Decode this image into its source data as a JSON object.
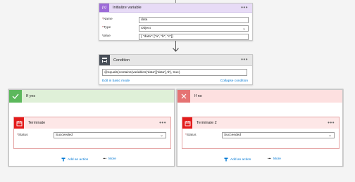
{
  "init_variable": {
    "title": "Initialize variable",
    "name_label": "Name",
    "name_value": "data",
    "type_label": "Type",
    "type_value": "Object",
    "value_label": "Value",
    "value_value": "{ \"data\": [\"a\", \"b\", \"c\"]}"
  },
  "condition": {
    "title": "Condition",
    "expression": "@equals(contains(variables('data')['data'],'d'), true)",
    "edit_link": "Edit in basic mode",
    "collapse_link": "Collapse condition"
  },
  "branches": {
    "yes": {
      "title": "If yes",
      "terminate_title": "Terminate",
      "status_label": "Status",
      "status_value": "Succeeded",
      "add_action": "Add an action",
      "more": "More"
    },
    "no": {
      "title": "If no",
      "terminate_title": "Terminate 2",
      "status_label": "Status",
      "status_value": "Succeeded",
      "add_action": "Add an action",
      "more": "More"
    }
  },
  "common": {
    "required_mark": "*",
    "dots": "•••"
  },
  "colors": {
    "variable_accent": "#9d6bd8",
    "variable_header": "#e7dbf6",
    "condition_accent": "#484f58",
    "condition_header": "#e6e6e6",
    "yes_header": "#dff0d8",
    "yes_icon": "#5cb85c",
    "no_header": "#fde0e0",
    "no_icon": "#e57373",
    "terminate_icon": "#e31b1b",
    "link": "#0078d4"
  }
}
